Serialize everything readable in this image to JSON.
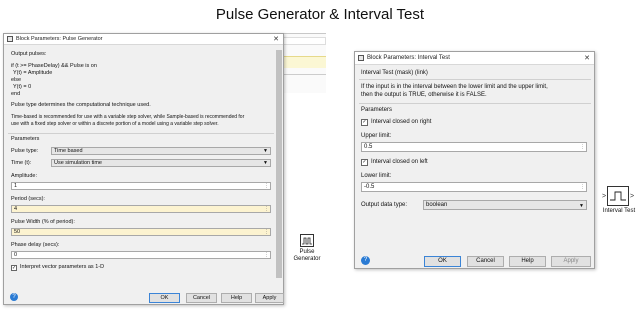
{
  "page": {
    "title": "Pulse Generator & Interval Test"
  },
  "canvas": {
    "pulse_block_label_1": "Pulse",
    "pulse_block_label_2": "Generator",
    "interval_block_label": "Interval Test",
    "interval_in_port": ">",
    "interval_out_port": ">"
  },
  "pulse_dialog": {
    "title": "Block Parameters: Pulse Generator",
    "close": "✕",
    "description": {
      "heading": "Output pulses:",
      "line1": "if (t >= PhaseDelay) && Pulse is on",
      "line2": "  Y(t) = Amplitude",
      "line3": "else",
      "line4": "  Y(t) = 0",
      "line5": "end",
      "para1": "Pulse type determines the computational technique used.",
      "para2a": "Time-based is recommended for use with a variable step solver, while Sample-based is recommended for",
      "para2b": "use with a fixed step solver or within a discrete portion of a model using a variable step solver."
    },
    "parameters_heading": "Parameters",
    "pulse_type_label": "Pulse type:",
    "pulse_type_value": "Time based",
    "time_label": "Time (t):",
    "time_value": "Use simulation time",
    "amplitude_label": "Amplitude:",
    "amplitude_value": "1",
    "period_label": "Period (secs):",
    "period_value": "4",
    "pulse_width_label": "Pulse Width (% of period):",
    "pulse_width_value": "50",
    "phase_delay_label": "Phase delay (secs):",
    "phase_delay_value": "0",
    "interpret_label": "Interpret vector parameters as 1-D",
    "interpret_checked": "✓",
    "ok": "OK",
    "cancel": "Cancel",
    "help": "Help",
    "apply": "Apply",
    "help_icon": "?",
    "spin": "⋮"
  },
  "interval_dialog": {
    "title": "Block Parameters: Interval Test",
    "close": "✕",
    "subtitle": "Interval Test (mask) (link)",
    "desc1": "If the input is in the interval between the lower limit and the upper limit,",
    "desc2": "then the output is TRUE, otherwise it is FALSE.",
    "parameters_heading": "Parameters",
    "closed_right_label": "Interval closed on right",
    "closed_right_checked": "✓",
    "upper_label": "Upper limit:",
    "upper_value": "0.5",
    "closed_left_label": "Interval closed on left",
    "closed_left_checked": "✓",
    "lower_label": "Lower limit:",
    "lower_value": "-0.5",
    "output_type_label": "Output data type:",
    "output_type_value": "boolean",
    "ok": "OK",
    "cancel": "Cancel",
    "help": "Help",
    "apply": "Apply",
    "help_icon": "?",
    "spin": "⋮"
  }
}
